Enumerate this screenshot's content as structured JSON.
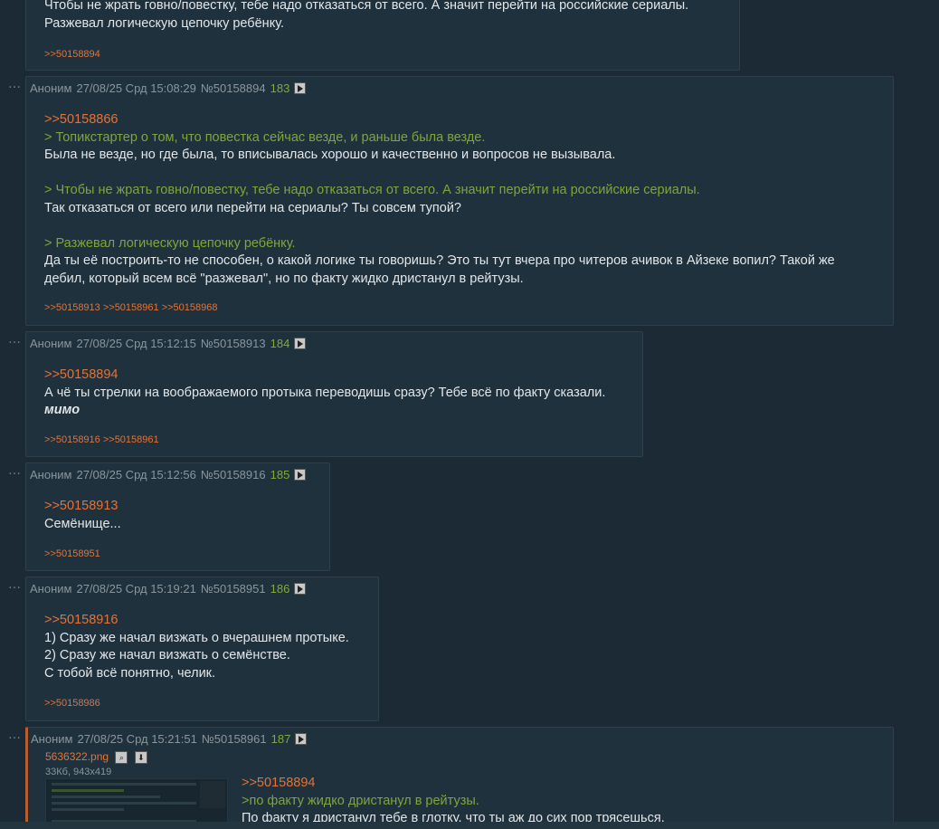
{
  "play_icon": "play-icon",
  "posts": [
    {
      "body": [
        {
          "type": "text",
          "text": "Чтобы не жрать говно/повестку, тебе надо отказаться от всего. А значит перейти на российские сериалы."
        },
        {
          "type": "text",
          "text": "Разжевал логическую цепочку ребёнку."
        }
      ],
      "replies": ">>50158894"
    },
    {
      "author": "Аноним",
      "date": "27/08/25 Срд 15:08:29",
      "id": "№50158894",
      "num": "183",
      "body": [
        {
          "type": "link",
          "text": ">>50158866"
        },
        {
          "type": "quote",
          "text": "> Топикстартер о том, что повестка сейчас везде, и раньше была везде."
        },
        {
          "type": "text",
          "text": "Была не везде, но где была, то вписывалась хорошо и качественно и вопросов не вызывала."
        },
        {
          "type": "empty",
          "text": ""
        },
        {
          "type": "quote",
          "text": "> Чтобы не жрать говно/повестку, тебе надо отказаться от всего. А значит перейти на российские сериалы."
        },
        {
          "type": "text",
          "text": "Так отказаться от всего или перейти на сериалы? Ты совсем тупой?"
        },
        {
          "type": "empty",
          "text": ""
        },
        {
          "type": "quote",
          "text": "> Разжевал логическую цепочку ребёнку."
        },
        {
          "type": "text",
          "text": "Да ты её построить-то не способен, о какой логике ты говоришь? Это ты тут вчера про читеров ачивок в Айзеке вопил? Такой же"
        },
        {
          "type": "text",
          "text": "дебил, который всем всё \"разжевал\", но по факту жидко дристанул в рейтузы."
        }
      ],
      "replies": ">>50158913 >>50158961 >>50158968"
    },
    {
      "author": "Аноним",
      "date": "27/08/25 Срд 15:12:15",
      "id": "№50158913",
      "num": "184",
      "body": [
        {
          "type": "link",
          "text": ">>50158894"
        },
        {
          "type": "text",
          "text": "А чё ты стрелки на воображаемого протыка переводишь сразу? Тебе всё по факту сказали."
        },
        {
          "type": "italic",
          "text": "мимо"
        }
      ],
      "replies": ">>50158916 >>50158961"
    },
    {
      "author": "Аноним",
      "date": "27/08/25 Срд 15:12:56",
      "id": "№50158916",
      "num": "185",
      "body": [
        {
          "type": "link",
          "text": ">>50158913"
        },
        {
          "type": "text",
          "text": "Семёнище..."
        }
      ],
      "replies": ">>50158951"
    },
    {
      "author": "Аноним",
      "date": "27/08/25 Срд 15:19:21",
      "id": "№50158951",
      "num": "186",
      "body": [
        {
          "type": "link",
          "text": ">>50158916"
        },
        {
          "type": "text",
          "text": "1) Сразу же начал визжать о вчерашнем протыке."
        },
        {
          "type": "text",
          "text": "2) Сразу же начал визжать о семёнстве."
        },
        {
          "type": "text",
          "text": "С тобой всё понятно, челик."
        }
      ],
      "replies": ">>50158986"
    },
    {
      "author": "Аноним",
      "date": "27/08/25 Срд 15:21:51",
      "id": "№50158961",
      "num": "187",
      "file": {
        "name": "5636322.png",
        "meta": "33Кб, 943x419"
      },
      "body": [
        {
          "type": "link",
          "text": ">>50158894"
        },
        {
          "type": "quote",
          "text": ">по факту жидко дристанул в рейтузы."
        },
        {
          "type": "text",
          "text": "По факту я дристанул тебе в глотку, что ты аж до сих пор трясешься."
        }
      ],
      "replies": ""
    }
  ]
}
